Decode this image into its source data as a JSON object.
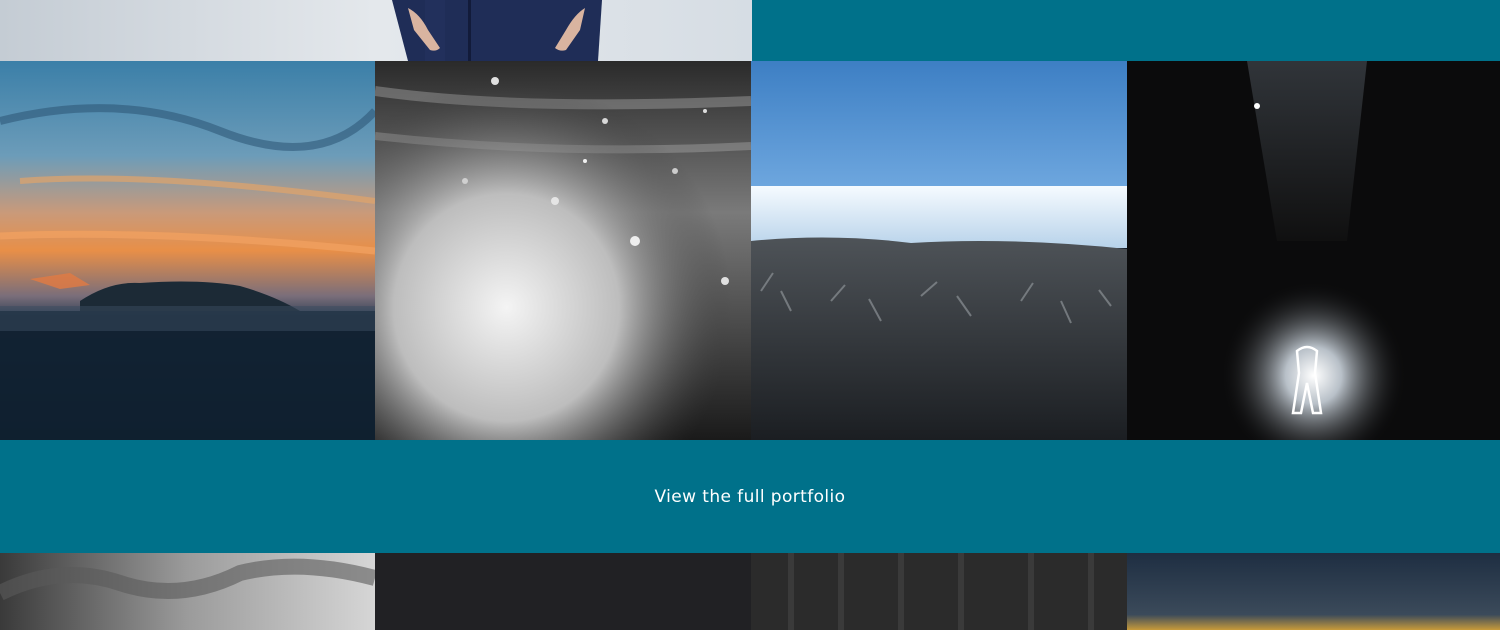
{
  "cta": {
    "label": "View the full portfolio"
  },
  "colors": {
    "band": "#00718a",
    "accent": "#00718a"
  },
  "gallery": {
    "top_row": [
      {
        "name": "person-standing-photo"
      },
      {
        "name": "teal-band-panel"
      }
    ],
    "middle_row": [
      {
        "name": "sunset-island-photo"
      },
      {
        "name": "wave-splash-photo"
      },
      {
        "name": "sea-grass-photo"
      },
      {
        "name": "light-figure-forest-photo"
      }
    ],
    "bottom_row": [
      {
        "name": "clouds-photo"
      },
      {
        "name": "dark-night-photo"
      },
      {
        "name": "dark-forest-photo"
      },
      {
        "name": "dusk-horizon-photo"
      }
    ]
  }
}
